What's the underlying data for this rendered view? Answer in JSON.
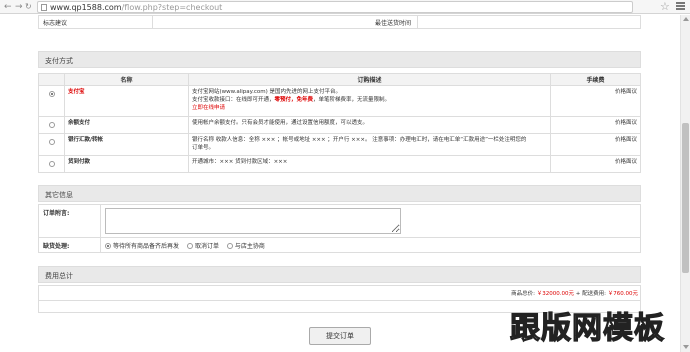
{
  "browser": {
    "url_host": "www.qp1588.com",
    "url_path": "/flow.php?step=checkout"
  },
  "top_row": {
    "cell1": "标志建议",
    "cell2": "最佳送货时间"
  },
  "payment": {
    "section_title": "支付方式",
    "headers": {
      "name": "名称",
      "desc": "订购描述",
      "fee": "手续费"
    },
    "items": [
      {
        "name": "支付宝",
        "desc_line1": "支付宝网站(www.alipay.com) 是国内先进的网上支付平台。",
        "desc_line2_a": "支付宝收款接口：在线即可开通，",
        "desc_line2_b": "零预付，免年费",
        "desc_line2_c": "，单笔阶梯费率，无流量限制。",
        "link": "立即在线申请",
        "fee": "价格面议",
        "selected": true
      },
      {
        "name": "余额支付",
        "desc_line1": "使用帐户余额支付。只有会员才能使用，通过设置信用额度，可以透支。",
        "fee": "价格面议",
        "selected": false
      },
      {
        "name": "银行汇款/转帐",
        "desc_line1": "银行名称 收款人信息：全称 ××× ；帐号或地址 ××× ；开户行 ×××。 注意事项：办理电汇时，请在电汇单“汇款用途”一栏处注明您的",
        "desc_line2": "订单号。",
        "fee": "价格面议",
        "selected": false
      },
      {
        "name": "货到付款",
        "desc_line1": "开通城市：××× 货到付款区域：×××",
        "fee": "价格面议",
        "selected": false
      }
    ]
  },
  "other": {
    "section_title": "其它信息",
    "message_label": "订单附言:",
    "stock_label": "缺货处理:",
    "stock_options": [
      "等待所有商品备齐后再发",
      "取消订单",
      "与店主协商"
    ]
  },
  "fees": {
    "section_title": "费用总计",
    "total_prefix": "商品总价:",
    "total_amount": "￥32000.00元",
    "shipping_prefix": " + 配送费用:",
    "shipping_amount": "￥760.00元"
  },
  "submit_label": "提交订单",
  "watermark": "跟版网模板"
}
